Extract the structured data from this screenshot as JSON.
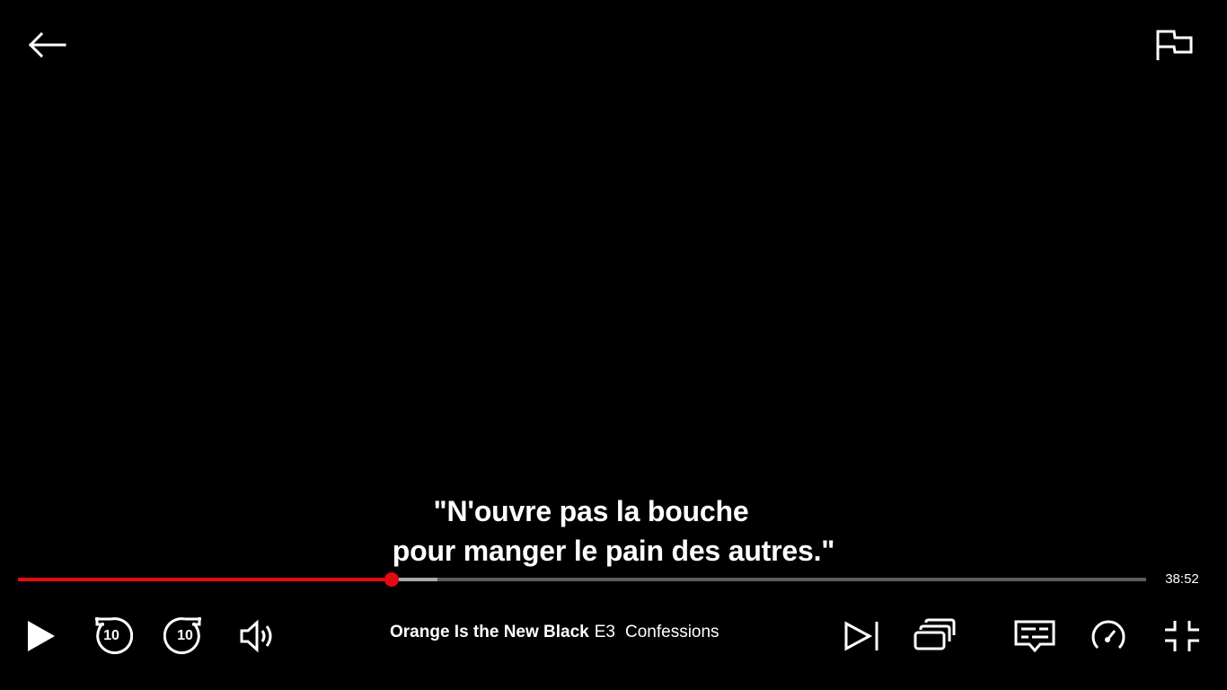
{
  "top": {
    "back_icon": "arrow-left-icon",
    "report_icon": "flag-icon"
  },
  "subtitle": {
    "line1": "\"N'ouvre pas la bouche",
    "line2": "pour manger le pain des autres.\""
  },
  "timeline": {
    "played_fraction": 0.331,
    "buffered_fraction": 0.372,
    "time_remaining": "38:52"
  },
  "controls": {
    "play_icon": "play-icon",
    "rewind_icon": "rewind-10-icon",
    "rewind_seconds": "10",
    "forward_icon": "forward-10-icon",
    "forward_seconds": "10",
    "volume_icon": "volume-icon",
    "next_episode_icon": "next-episode-icon",
    "episodes_icon": "episodes-icon",
    "subtitles_icon": "subtitles-icon",
    "speed_icon": "playback-speed-icon",
    "fullscreen_icon": "exit-fullscreen-icon"
  },
  "title_info": {
    "show": "Orange Is the New Black",
    "episode": "E3",
    "episode_title": "Confessions"
  },
  "colors": {
    "accent": "#e50914",
    "background": "#000000",
    "text": "#ffffff"
  }
}
